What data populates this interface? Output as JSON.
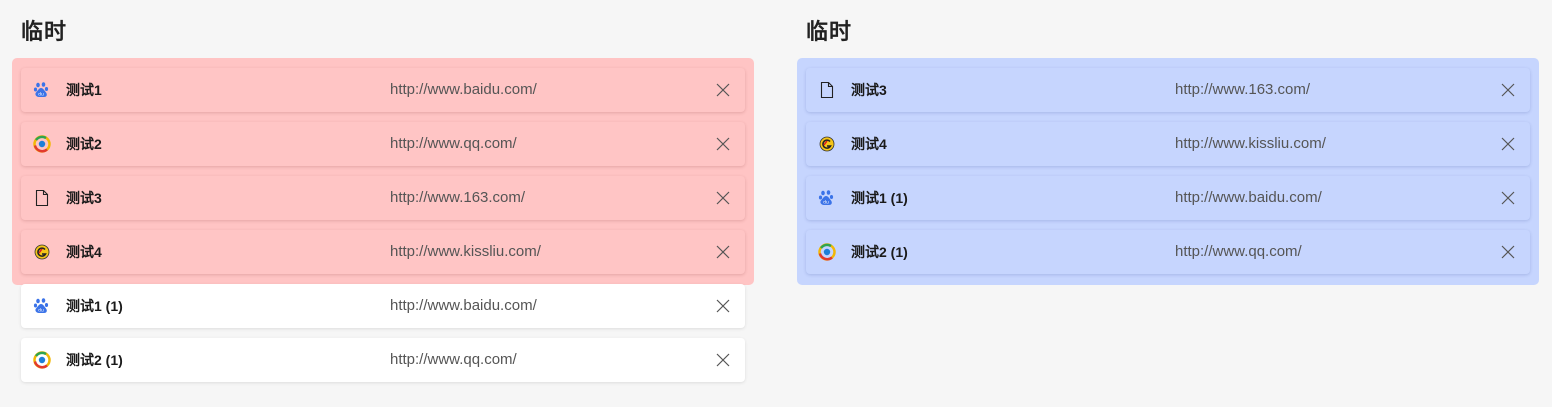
{
  "left_panel": {
    "title": "临时",
    "group_color": "#ffc4c4",
    "rows": [
      {
        "title": "测试1",
        "url": "http://www.baidu.com/",
        "icon": "baidu-icon"
      },
      {
        "title": "测试2",
        "url": "http://www.qq.com/",
        "icon": "qq-icon"
      },
      {
        "title": "测试3",
        "url": "http://www.163.com/",
        "icon": "document-icon"
      },
      {
        "title": "测试4",
        "url": "http://www.kissliu.com/",
        "icon": "kissliu-icon"
      },
      {
        "title": "测试1 (1)",
        "url": "http://www.baidu.com/",
        "icon": "baidu-icon"
      },
      {
        "title": "测试2 (1)",
        "url": "http://www.qq.com/",
        "icon": "qq-icon"
      }
    ]
  },
  "right_panel": {
    "title": "临时",
    "group_color": "#c6d5fe",
    "rows": [
      {
        "title": "测试3",
        "url": "http://www.163.com/",
        "icon": "document-icon"
      },
      {
        "title": "测试4",
        "url": "http://www.kissliu.com/",
        "icon": "kissliu-icon"
      },
      {
        "title": "测试1 (1)",
        "url": "http://www.baidu.com/",
        "icon": "baidu-icon"
      },
      {
        "title": "测试2 (1)",
        "url": "http://www.qq.com/",
        "icon": "qq-icon"
      }
    ]
  },
  "close_icon": "close-icon"
}
